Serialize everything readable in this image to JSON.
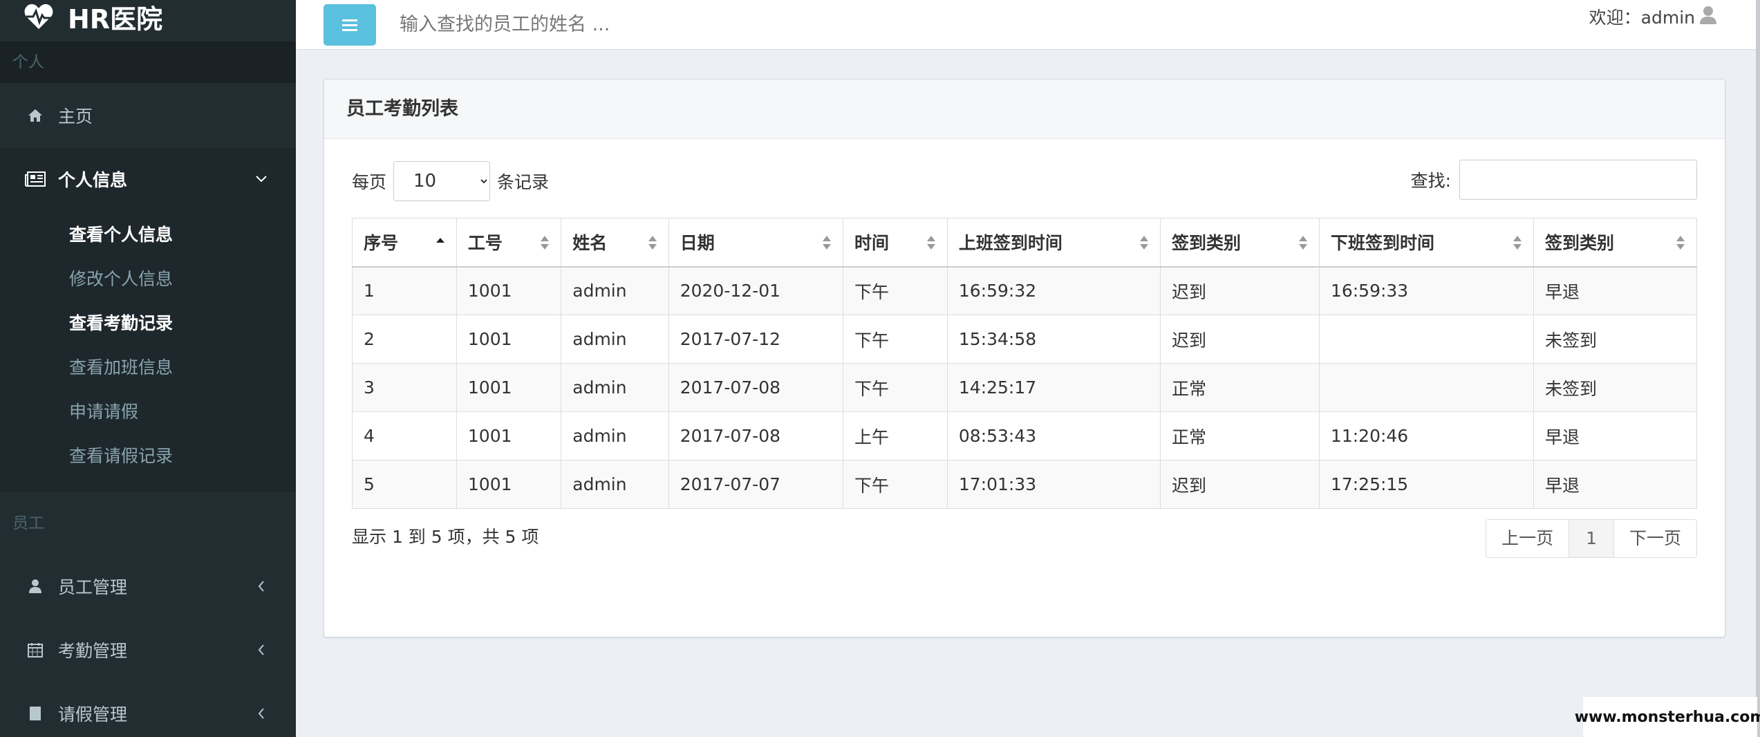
{
  "app": {
    "logo_text": "HR医院"
  },
  "sidebar": {
    "section_personal": "个人",
    "home_label": "主页",
    "personal_info_label": "个人信息",
    "sub_items": [
      {
        "label": "查看个人信息",
        "bright": true
      },
      {
        "label": "修改个人信息",
        "bright": false
      },
      {
        "label": "查看考勤记录",
        "bright": true
      },
      {
        "label": "查看加班信息",
        "bright": false
      },
      {
        "label": "申请请假",
        "bright": false
      },
      {
        "label": "查看请假记录",
        "bright": false
      }
    ],
    "section_employee": "员工",
    "employee_mgmt_label": "员工管理",
    "attendance_mgmt_label": "考勤管理",
    "leave_mgmt_label": "请假管理"
  },
  "header": {
    "search_placeholder": "输入查找的员工的姓名 ...",
    "welcome": "欢迎：admin"
  },
  "box": {
    "title": "员工考勤列表",
    "per_page_prefix": "每页",
    "per_page_value": "10",
    "per_page_suffix": "条记录",
    "find_label": "查找:",
    "columns": [
      "序号",
      "工号",
      "姓名",
      "日期",
      "时间",
      "上班签到时间",
      "签到类别",
      "下班签到时间",
      "签到类别"
    ],
    "rows": [
      [
        "1",
        "1001",
        "admin",
        "2020-12-01",
        "下午",
        "16:59:32",
        "迟到",
        "16:59:33",
        "早退"
      ],
      [
        "2",
        "1001",
        "admin",
        "2017-07-12",
        "下午",
        "15:34:58",
        "迟到",
        "",
        "未签到"
      ],
      [
        "3",
        "1001",
        "admin",
        "2017-07-08",
        "下午",
        "14:25:17",
        "正常",
        "",
        "未签到"
      ],
      [
        "4",
        "1001",
        "admin",
        "2017-07-08",
        "上午",
        "08:53:43",
        "正常",
        "11:20:46",
        "早退"
      ],
      [
        "5",
        "1001",
        "admin",
        "2017-07-07",
        "下午",
        "17:01:33",
        "迟到",
        "17:25:15",
        "早退"
      ]
    ],
    "info_text": "显示 1 到 5 项，共 5 项",
    "pager": {
      "prev": "上一页",
      "current": "1",
      "next": "下一页"
    }
  },
  "watermark": "www.monsterhua.com",
  "colors": {
    "sidebar_bg": "#222d32",
    "toggle_btn": "#5bc0de",
    "content_bg": "#ecf0f5"
  }
}
